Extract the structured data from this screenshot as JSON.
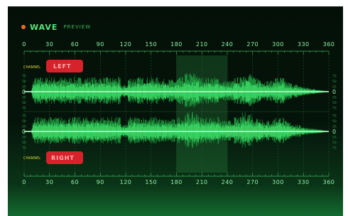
{
  "header": {
    "title": "WAVE",
    "subtitle": "PREVIEW",
    "indicator_color": "#f06a23"
  },
  "timeline": {
    "ticks": [
      "0",
      "30",
      "60",
      "90",
      "120",
      "150",
      "180",
      "210",
      "240",
      "270",
      "300",
      "330",
      "360"
    ]
  },
  "channels": [
    {
      "prefix": "CHANNEL",
      "name": "LEFT"
    },
    {
      "prefix": "CHANNEL",
      "name": "RIGHT"
    }
  ],
  "level_scale": {
    "top_labels": [
      "75",
      "50",
      "25"
    ],
    "zero": "0",
    "bottom_labels": [
      "25",
      "50",
      "75"
    ]
  },
  "selection": {
    "start": 180,
    "end": 240
  },
  "colors": {
    "accent": "#56e37a",
    "wave": "#2fd35a",
    "badge": "#d6222a"
  }
}
